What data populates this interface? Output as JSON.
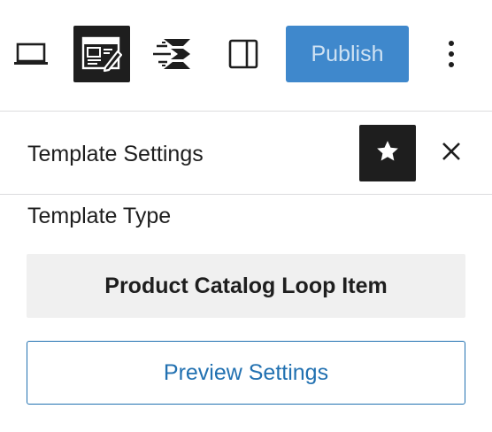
{
  "toolbar": {
    "icons": {
      "preview": "laptop-icon",
      "template_editor": "template-editor-icon",
      "plugin": "speed-lines-plugin-icon",
      "sidebar_toggle": "sidebar-toggle-icon",
      "more": "more-vertical-icon"
    },
    "publish_label": "Publish"
  },
  "panel": {
    "title": "Template Settings",
    "star_icon": "star-icon",
    "close_icon": "close-icon"
  },
  "template_type": {
    "label": "Template Type",
    "value": "Product Catalog Loop Item"
  },
  "preview_settings_label": "Preview Settings",
  "colors": {
    "publish_bg": "#3f88cc",
    "publish_text": "#cfe2f3",
    "accent_blue": "#2271b1",
    "dark": "#1e1e1e",
    "type_box_bg": "#f0f0f0",
    "divider": "#dcdcde"
  }
}
